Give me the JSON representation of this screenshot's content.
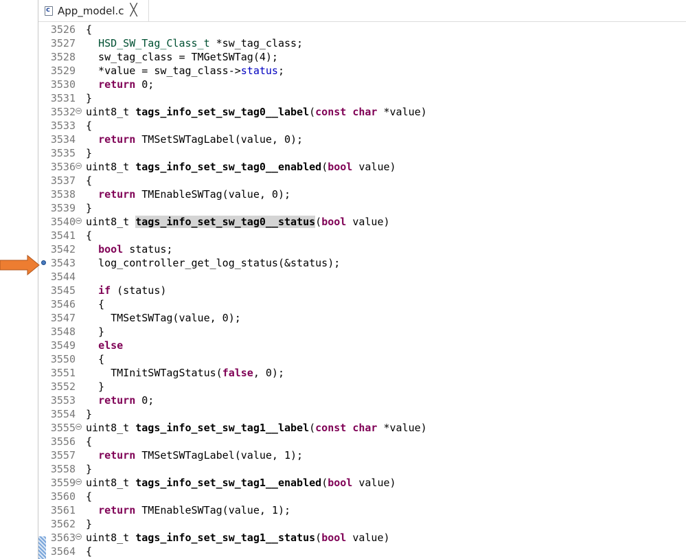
{
  "tab": {
    "title": "App_model.c",
    "icon": "c-source-file-icon",
    "close_label": "╳"
  },
  "colors": {
    "keyword": "#7f0055",
    "type": "#005032",
    "field": "#0000c0",
    "line_number": "#787878",
    "arrow": "#ed7d31",
    "breakpoint": "#4a7bbf"
  },
  "breakpoint_line": "3543",
  "lines": [
    {
      "n": "3526",
      "c": "{"
    },
    {
      "n": "3527",
      "c": "  HSD_SW_Tag_Class_t *sw_tag_class;"
    },
    {
      "n": "3528",
      "c": "  sw_tag_class = TMGetSWTag(4);"
    },
    {
      "n": "3529",
      "c": "  *value = sw_tag_class->status;"
    },
    {
      "n": "3530",
      "c": "  return 0;"
    },
    {
      "n": "3531",
      "c": "}"
    },
    {
      "n": "3532",
      "c": "uint8_t tags_info_set_sw_tag0__label(const char *value)"
    },
    {
      "n": "3533",
      "c": "{"
    },
    {
      "n": "3534",
      "c": "  return TMSetSWTagLabel(value, 0);"
    },
    {
      "n": "3535",
      "c": "}"
    },
    {
      "n": "3536",
      "c": "uint8_t tags_info_set_sw_tag0__enabled(bool value)"
    },
    {
      "n": "3537",
      "c": "{"
    },
    {
      "n": "3538",
      "c": "  return TMEnableSWTag(value, 0);"
    },
    {
      "n": "3539",
      "c": "}"
    },
    {
      "n": "3540",
      "c": "uint8_t tags_info_set_sw_tag0__status(bool value)"
    },
    {
      "n": "3541",
      "c": "{"
    },
    {
      "n": "3542",
      "c": "  bool status;"
    },
    {
      "n": "3543",
      "c": "  log_controller_get_log_status(&status);"
    },
    {
      "n": "3544",
      "c": ""
    },
    {
      "n": "3545",
      "c": "  if (status)"
    },
    {
      "n": "3546",
      "c": "  {"
    },
    {
      "n": "3547",
      "c": "    TMSetSWTag(value, 0);"
    },
    {
      "n": "3548",
      "c": "  }"
    },
    {
      "n": "3549",
      "c": "  else"
    },
    {
      "n": "3550",
      "c": "  {"
    },
    {
      "n": "3551",
      "c": "    TMInitSWTagStatus(false, 0);"
    },
    {
      "n": "3552",
      "c": "  }"
    },
    {
      "n": "3553",
      "c": "  return 0;"
    },
    {
      "n": "3554",
      "c": "}"
    },
    {
      "n": "3555",
      "c": "uint8_t tags_info_set_sw_tag1__label(const char *value)"
    },
    {
      "n": "3556",
      "c": "{"
    },
    {
      "n": "3557",
      "c": "  return TMSetSWTagLabel(value, 1);"
    },
    {
      "n": "3558",
      "c": "}"
    },
    {
      "n": "3559",
      "c": "uint8_t tags_info_set_sw_tag1__enabled(bool value)"
    },
    {
      "n": "3560",
      "c": "{"
    },
    {
      "n": "3561",
      "c": "  return TMEnableSWTag(value, 1);"
    },
    {
      "n": "3562",
      "c": "}"
    },
    {
      "n": "3563",
      "c": "uint8_t tags_info_set_sw_tag1__status(bool value)"
    },
    {
      "n": "3564",
      "c": "{"
    }
  ]
}
